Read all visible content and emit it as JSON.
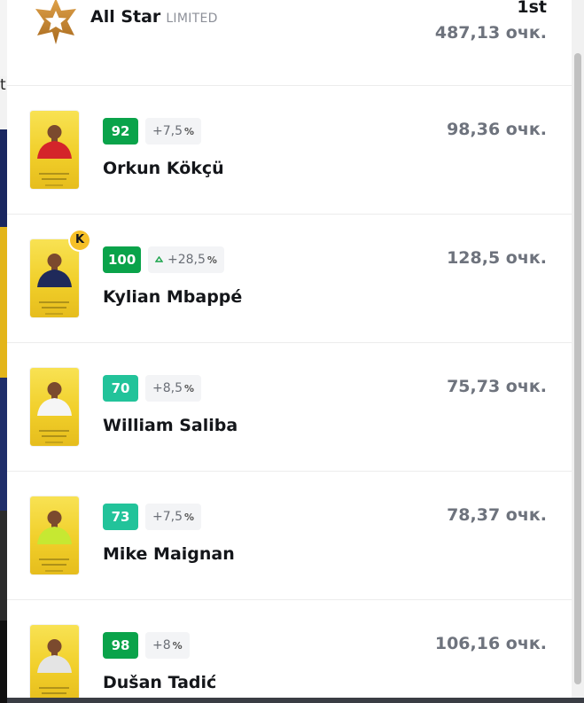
{
  "colors": {
    "score_high": "#0aa34a",
    "score_mid": "#22c39a",
    "card_gold": "#f1cf2a",
    "points_gray": "#6e737d",
    "captain_badge": "#f6c028",
    "bonus_arrow": "#1aa34a"
  },
  "header": {
    "icon": "star-badge-icon",
    "title": "All Star",
    "subtitle": "LIMITED",
    "rank": "1st",
    "total": "487,13 очк."
  },
  "background": {
    "partial_letter": "t"
  },
  "players": [
    {
      "name": "Orkun Kökçü",
      "score": "92",
      "score_level": "high",
      "bonus": "+7,5",
      "bonus_up": false,
      "points": "98,36 очк.",
      "captain": false,
      "card_name_line1": "Orkun",
      "card_name_line2": "Kökçü"
    },
    {
      "name": "Kylian Mbappé",
      "score": "100",
      "score_level": "high",
      "bonus": "+28,5",
      "bonus_up": true,
      "points": "128,5 очк.",
      "captain": true,
      "captain_label": "K",
      "card_name_line1": "Kylian",
      "card_name_line2": "Mbappé"
    },
    {
      "name": "William Saliba",
      "score": "70",
      "score_level": "mid",
      "bonus": "+8,5",
      "bonus_up": false,
      "points": "75,73 очк.",
      "captain": false,
      "card_name_line1": "William",
      "card_name_line2": "Saliba"
    },
    {
      "name": "Mike Maignan",
      "score": "73",
      "score_level": "mid",
      "bonus": "+7,5",
      "bonus_up": false,
      "points": "78,37 очк.",
      "captain": false,
      "card_name_line1": "Mike",
      "card_name_line2": "Maignan"
    },
    {
      "name": "Dušan Tadić",
      "score": "98",
      "score_level": "high",
      "bonus": "+8",
      "bonus_up": false,
      "points": "106,16 очк.",
      "captain": false,
      "card_name_line1": "Dušan",
      "card_name_line2": "Tadić"
    }
  ],
  "bonus_unit": "%"
}
